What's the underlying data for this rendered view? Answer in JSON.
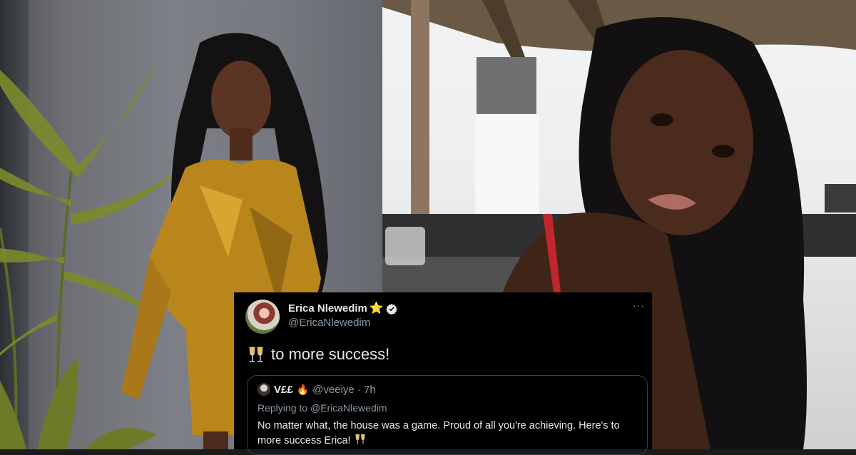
{
  "tweet": {
    "author_name": "Erica Nlewedim",
    "author_handle": "@EricaNlewedim",
    "star_emoji": "⭐",
    "more_menu": "···",
    "body_text": "to more success!",
    "body_emoji_name": "clinking-glasses-icon",
    "quoted": {
      "name": "V££",
      "fire_emoji": "🔥",
      "handle_time": "@veeiye · 7h",
      "replying_prefix": "Replying to",
      "replying_to": "@EricaNlewedim",
      "text": "No matter what, the house was a game. Proud of all you're achieving. Here's to more success Erica!"
    }
  },
  "colors": {
    "tweet_bg": "#000000",
    "text_primary": "#e7e9ea",
    "text_secondary": "#8b98a5",
    "verified_blue": "#e7e9ea",
    "star": "#f5b301",
    "dress_gold": "#c8941c"
  }
}
